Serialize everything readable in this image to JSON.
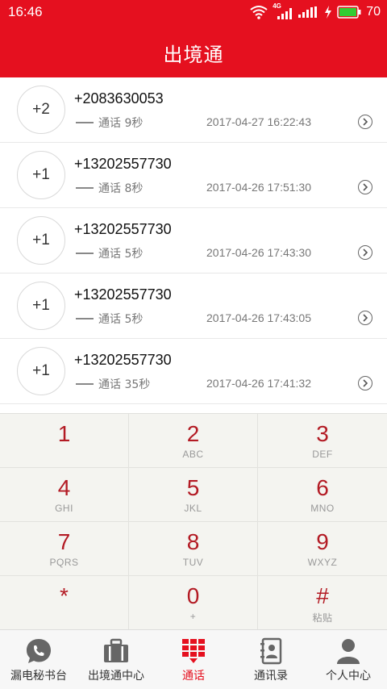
{
  "status_bar": {
    "time": "16:46",
    "network_label": "4G",
    "battery_level": "70",
    "icons": [
      "wifi-icon",
      "signal-4g-icon",
      "signal-icon",
      "charging-icon",
      "battery-icon"
    ]
  },
  "header": {
    "title": "出境通"
  },
  "colors": {
    "brand_red": "#e5101f",
    "digit_red": "#b31b24",
    "keypad_bg": "#f4f4f0"
  },
  "calls": [
    {
      "count": "+2",
      "number": "+2083630053",
      "type": "通话 9秒",
      "datetime": "2017-04-27 16:22:43"
    },
    {
      "count": "+1",
      "number": "+13202557730",
      "type": "通话 8秒",
      "datetime": "2017-04-26 17:51:30"
    },
    {
      "count": "+1",
      "number": "+13202557730",
      "type": "通话 5秒",
      "datetime": "2017-04-26 17:43:30"
    },
    {
      "count": "+1",
      "number": "+13202557730",
      "type": "通话 5秒",
      "datetime": "2017-04-26 17:43:05"
    },
    {
      "count": "+1",
      "number": "+13202557730",
      "type": "通话 35秒",
      "datetime": "2017-04-26 17:41:32"
    }
  ],
  "keypad": [
    {
      "digit": "1",
      "letters": ""
    },
    {
      "digit": "2",
      "letters": "ABC"
    },
    {
      "digit": "3",
      "letters": "DEF"
    },
    {
      "digit": "4",
      "letters": "GHI"
    },
    {
      "digit": "5",
      "letters": "JKL"
    },
    {
      "digit": "6",
      "letters": "MNO"
    },
    {
      "digit": "7",
      "letters": "PQRS"
    },
    {
      "digit": "8",
      "letters": "TUV"
    },
    {
      "digit": "9",
      "letters": "WXYZ"
    },
    {
      "digit": "*",
      "letters": ""
    },
    {
      "digit": "0",
      "letters": "+"
    },
    {
      "digit": "#",
      "letters": "粘贴"
    }
  ],
  "tabs": [
    {
      "label": "漏电秘书台",
      "icon": "phone-bubble-icon"
    },
    {
      "label": "出境通中心",
      "icon": "suitcase-icon"
    },
    {
      "label": "通话",
      "icon": "dialpad-icon",
      "active": true
    },
    {
      "label": "通讯录",
      "icon": "contacts-book-icon"
    },
    {
      "label": "个人中心",
      "icon": "person-icon"
    }
  ]
}
